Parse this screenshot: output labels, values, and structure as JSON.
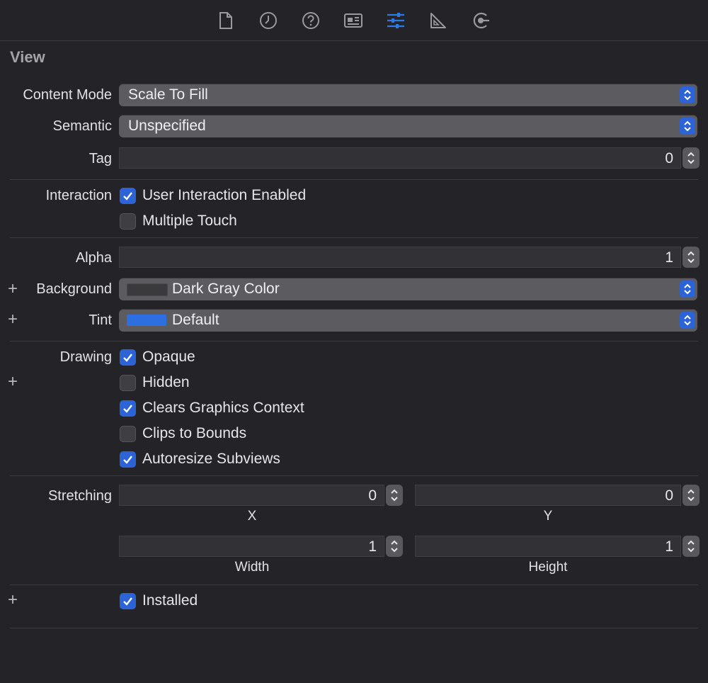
{
  "toolbar": {
    "icons": [
      "file-icon",
      "history-icon",
      "help-icon",
      "identity-icon",
      "attributes-icon",
      "size-ruler-icon",
      "connections-icon"
    ],
    "active": "attributes-icon",
    "accent": "#2c63d7"
  },
  "section": {
    "title": "View"
  },
  "content_mode": {
    "label": "Content Mode",
    "value": "Scale To Fill"
  },
  "semantic": {
    "label": "Semantic",
    "value": "Unspecified"
  },
  "tag": {
    "label": "Tag",
    "value": "0"
  },
  "interaction": {
    "label": "Interaction",
    "user_interaction": {
      "label": "User Interaction Enabled",
      "checked": true
    },
    "multiple_touch": {
      "label": "Multiple Touch",
      "checked": false
    }
  },
  "alpha": {
    "label": "Alpha",
    "value": "1"
  },
  "background": {
    "label": "Background",
    "value": "Dark Gray Color",
    "swatch": "#3a3a3c"
  },
  "tint": {
    "label": "Tint",
    "value": "Default",
    "swatch": "#2d6fe0"
  },
  "drawing": {
    "label": "Drawing",
    "opaque": {
      "label": "Opaque",
      "checked": true
    },
    "hidden": {
      "label": "Hidden",
      "checked": false
    },
    "clears_graphics": {
      "label": "Clears Graphics Context",
      "checked": true
    },
    "clips_to_bounds": {
      "label": "Clips to Bounds",
      "checked": false
    },
    "autoresize": {
      "label": "Autoresize Subviews",
      "checked": true
    }
  },
  "stretching": {
    "label": "Stretching",
    "x": {
      "label": "X",
      "value": "0"
    },
    "y": {
      "label": "Y",
      "value": "0"
    },
    "width": {
      "label": "Width",
      "value": "1"
    },
    "height": {
      "label": "Height",
      "value": "1"
    }
  },
  "installed": {
    "label": "Installed",
    "checked": true
  }
}
